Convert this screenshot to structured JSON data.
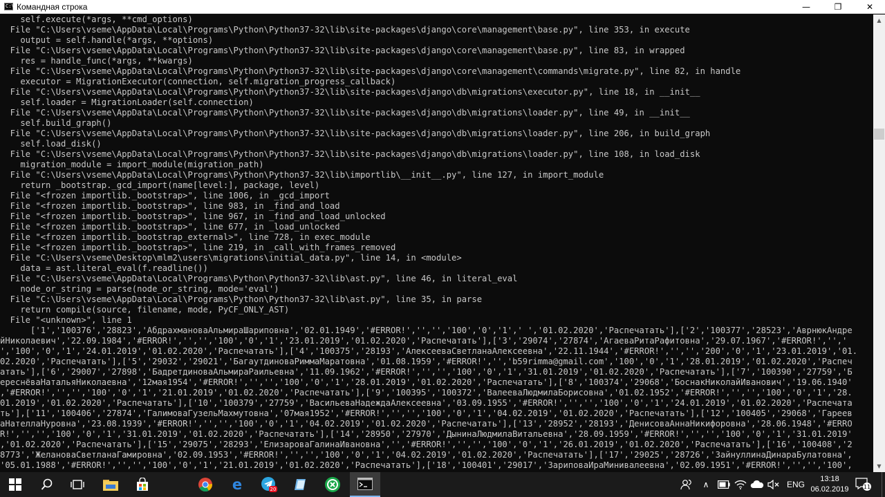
{
  "window": {
    "title": "Командная строка",
    "minimize_symbol": "—",
    "maximize_symbol": "❐",
    "close_symbol": "✕"
  },
  "console_lines": [
    "    self.execute(*args, **cmd_options)",
    "  File \"C:\\Users\\vseme\\AppData\\Local\\Programs\\Python\\Python37-32\\lib\\site-packages\\django\\core\\management\\base.py\", line 353, in execute",
    "    output = self.handle(*args, **options)",
    "  File \"C:\\Users\\vseme\\AppData\\Local\\Programs\\Python\\Python37-32\\lib\\site-packages\\django\\core\\management\\base.py\", line 83, in wrapped",
    "    res = handle_func(*args, **kwargs)",
    "  File \"C:\\Users\\vseme\\AppData\\Local\\Programs\\Python\\Python37-32\\lib\\site-packages\\django\\core\\management\\commands\\migrate.py\", line 82, in handle",
    "    executor = MigrationExecutor(connection, self.migration_progress_callback)",
    "  File \"C:\\Users\\vseme\\AppData\\Local\\Programs\\Python\\Python37-32\\lib\\site-packages\\django\\db\\migrations\\executor.py\", line 18, in __init__",
    "    self.loader = MigrationLoader(self.connection)",
    "  File \"C:\\Users\\vseme\\AppData\\Local\\Programs\\Python\\Python37-32\\lib\\site-packages\\django\\db\\migrations\\loader.py\", line 49, in __init__",
    "    self.build_graph()",
    "  File \"C:\\Users\\vseme\\AppData\\Local\\Programs\\Python\\Python37-32\\lib\\site-packages\\django\\db\\migrations\\loader.py\", line 206, in build_graph",
    "    self.load_disk()",
    "  File \"C:\\Users\\vseme\\AppData\\Local\\Programs\\Python\\Python37-32\\lib\\site-packages\\django\\db\\migrations\\loader.py\", line 108, in load_disk",
    "    migration_module = import_module(migration_path)",
    "  File \"C:\\Users\\vseme\\AppData\\Local\\Programs\\Python\\Python37-32\\lib\\importlib\\__init__.py\", line 127, in import_module",
    "    return _bootstrap._gcd_import(name[level:], package, level)",
    "  File \"<frozen importlib._bootstrap>\", line 1006, in _gcd_import",
    "  File \"<frozen importlib._bootstrap>\", line 983, in _find_and_load",
    "  File \"<frozen importlib._bootstrap>\", line 967, in _find_and_load_unlocked",
    "  File \"<frozen importlib._bootstrap>\", line 677, in _load_unlocked",
    "  File \"<frozen importlib._bootstrap_external>\", line 728, in exec_module",
    "  File \"<frozen importlib._bootstrap>\", line 219, in _call_with_frames_removed",
    "  File \"C:\\Users\\vseme\\Desktop\\mlm2\\users\\migrations\\initial_data.py\", line 14, in <module>",
    "    data = ast.literal_eval(f.readline())",
    "  File \"C:\\Users\\vseme\\AppData\\Local\\Programs\\Python\\Python37-32\\lib\\ast.py\", line 46, in literal_eval",
    "    node_or_string = parse(node_or_string, mode='eval')",
    "  File \"C:\\Users\\vseme\\AppData\\Local\\Programs\\Python\\Python37-32\\lib\\ast.py\", line 35, in parse",
    "    return compile(source, filename, mode, PyCF_ONLY_AST)",
    "  File \"<unknown>\", line 1",
    "      ['1','100376','28823','АбдрахмановаАльмираШариповна','02.01.1949','#ERROR!','','','100','0','1',' ','01.02.2020','Распечатать'],['2','100377','28523','АврнюкАндре",
    "йНиколаевич','22.09.1984','#ERROR!','','','100','0','1','23.01.2019','01.02.2020','Распечатать'],['3','29074','27874','АгаеваРитаРафитовна','29.07.1967','#ERROR!','','",
    "','100','0','1','24.01.2019','01.02.2020','Распечатать'],['4','100375','28193','АлексееваСветланаАлексеевна','22.11.1944','#ERROR!','','','200','0','1','23.01.2019','01.",
    "02.2020','Распечатать'],['5','29032','29021','БагаутдиноваРиммаМаратовна','01.08.1959','#ERROR!','','b59rimma@gmail.com','100','0','1','28.01.2019','01.02.2020','Распеч",
    "атать'],['6','29007','27898','БадретдиноваАльмираРаильевна','11.09.1962','#ERROR!','','','100','0','1','31.01.2019','01.02.2020','Распечатать'],['7','100390','27759','Б",
    "ереснёваНатальяНиколаевна','12мая1954','#ERROR!','','','100','0','1','28.01.2019','01.02.2020','Распечатать'],['8','100374','29068','БоснакНиколайИванович','19.06.1940'",
    ",'#ERROR!','','','100','0','1','21.01.2019','01.02.2020','Распечатать'],['9','100395','100372','ВалееваЛюдмилаБорисовна','01.02.1952','#ERROR!','','','100','0','1','28.",
    "01.2019','01.02.2020','Распечатать'],['10','100379','27759','ВасильеваНадеждаАлексеевна','03.09.1955','#ERROR!','','','100','0','1','24.01.2019','01.02.2020','Распечата",
    "ть'],['11','100406','27874','ГалимоваГузельМахмутовна','07мая1952','#ERROR!','','','100','0','1','04.02.2019','01.02.2020','Распечатать'],['12','100405','29068','Гареев",
    "аНателлаНуровна','23.08.1939','#ERROR!','','','100','0','1','04.02.2019','01.02.2020','Распечатать'],['13','28952','28193','ДенисоваАннаНикифоровна','28.06.1948','#ERRO",
    "R!','','','100','0','1','31.01.2019','01.02.2020','Распечатать'],['14','28950','27970','ДынинаЛюдмилаВитальевна','28.09.1959','#ERROR!','','','100','0','1','31.01.2019'",
    ",'01.02.2020','Распечатать'],['15','29075','28293','ЕлизароваГалинаИвановна','','#ERROR!','','','100','0','1','26.01.2019','01.02.2020','Распечатать'],['16','100408','2",
    "8773','ЖелановаСветланаГамировна','02.09.1953','#ERROR!','','','100','0','1','04.02.2019','01.02.2020','Распечатать'],['17','29025','28726','ЗайнуллинаДинараБулатовна',",
    "'05.01.1988','#ERROR!','','','100','0','1','21.01.2019','01.02.2020','Распечатать'],['18','100401','29017','ЗариповаИраМинивалеевна','02.09.1951','#ERROR!','','','100',"
  ],
  "taskbar": {
    "lang": "ENG",
    "time": "13:18",
    "date": "06.02.2019",
    "notification_count": "11",
    "badge_count": "20"
  },
  "colors": {
    "console_bg": "#0c0c0c",
    "console_text": "#c8c8c8",
    "taskbar_bg": "#1b1b1b"
  }
}
